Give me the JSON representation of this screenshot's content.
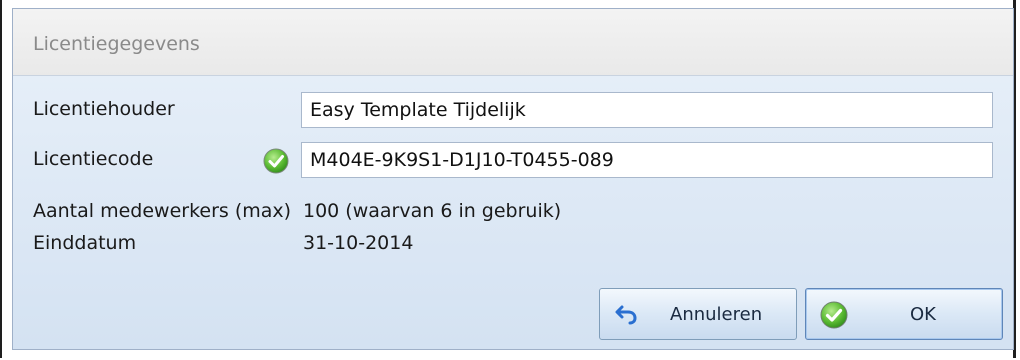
{
  "dialog": {
    "title": "Licentiegegevens"
  },
  "form": {
    "holder_label": "Licentiehouder",
    "holder_value": "Easy Template Tijdelijk",
    "code_label": "Licentiecode",
    "code_value": "M404E-9K9S1-D1J10-T0455-089",
    "code_status_icon": "check-valid-icon",
    "employees_label": "Aantal medewerkers (max)",
    "employees_value": "100 (waarvan 6 in gebruik)",
    "enddate_label": "Einddatum",
    "enddate_value": "31-10-2014"
  },
  "buttons": {
    "cancel_label": "Annuleren",
    "cancel_icon": "undo-icon",
    "ok_label": "OK",
    "ok_icon": "check-icon"
  },
  "colors": {
    "accent_green": "#4caf2e",
    "panel_blue": "#dfe9f5"
  }
}
